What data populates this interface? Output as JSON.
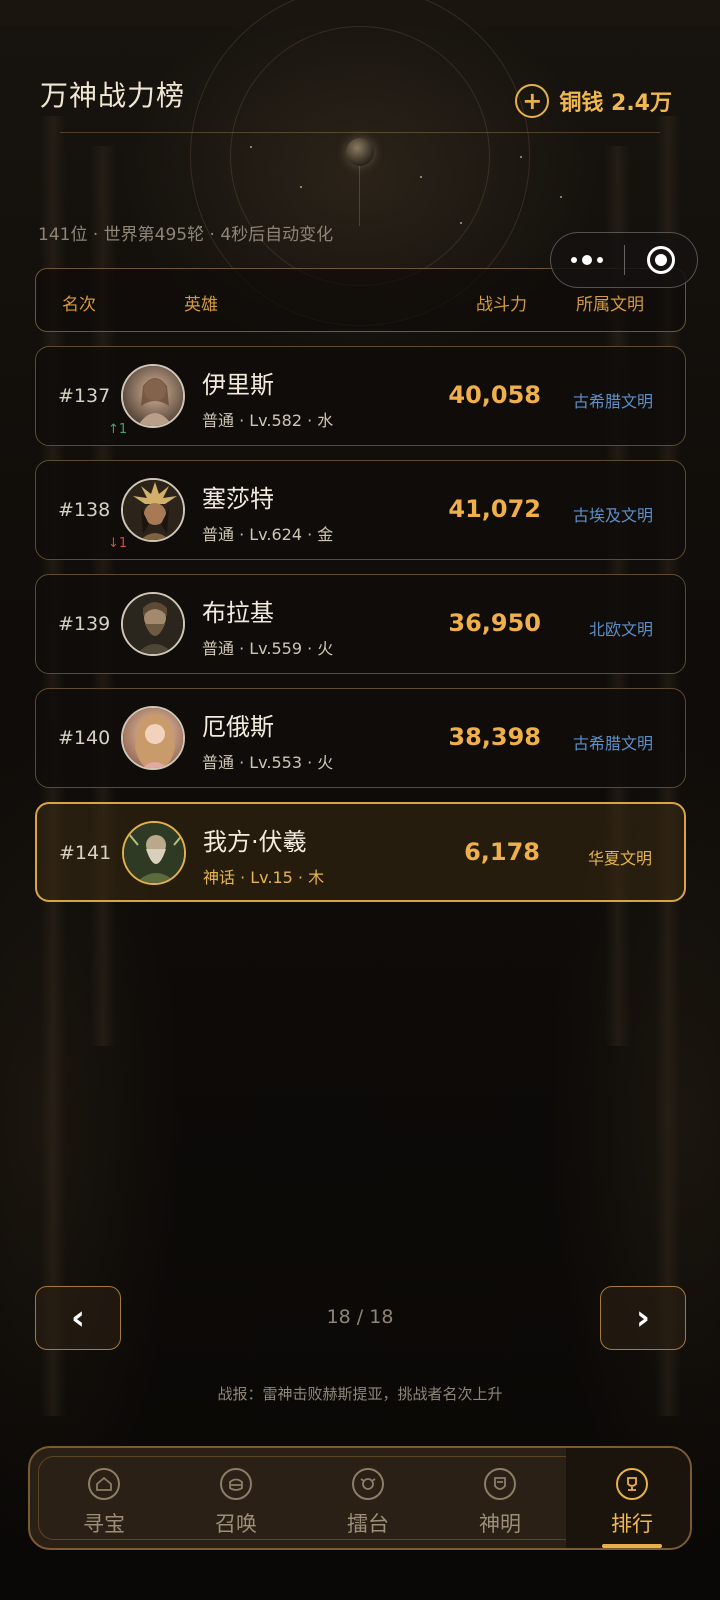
{
  "header": {
    "title": "万神战力榜",
    "coins_label": "铜钱 2.4万"
  },
  "subinfo": "141位 · 世界第495轮 · 4秒后自动变化",
  "table_header": {
    "rank": "名次",
    "hero": "英雄",
    "power": "战斗力",
    "civilization": "所属文明"
  },
  "rows": [
    {
      "rank": "#137",
      "name": "伊里斯",
      "meta": "普通 · Lv.582 · 水",
      "power": "40,058",
      "civ": "古希腊文明",
      "delta": "↑1",
      "delta_dir": "up",
      "avatar_color": "#8c6a55"
    },
    {
      "rank": "#138",
      "name": "塞莎特",
      "meta": "普通 · Lv.624 · 金",
      "power": "41,072",
      "civ": "古埃及文明",
      "delta": "↓1",
      "delta_dir": "down",
      "avatar_color": "#5a4a35"
    },
    {
      "rank": "#139",
      "name": "布拉基",
      "meta": "普通 · Lv.559 · 火",
      "power": "36,950",
      "civ": "北欧文明",
      "delta": "",
      "delta_dir": "",
      "avatar_color": "#5d5340"
    },
    {
      "rank": "#140",
      "name": "厄俄斯",
      "meta": "普通 · Lv.553 · 火",
      "power": "38,398",
      "civ": "古希腊文明",
      "delta": "",
      "delta_dir": "",
      "avatar_color": "#b07a63"
    },
    {
      "rank": "#141",
      "name": "我方·伏羲",
      "meta": "神话 · Lv.15 · 木",
      "power": "6,178",
      "civ": "华夏文明",
      "delta": "",
      "delta_dir": "",
      "avatar_color": "#4f5a3a"
    }
  ],
  "pager": {
    "prev": "‹",
    "next": "›",
    "page": "18 / 18"
  },
  "battle_report": "战报：雷神击败赫斯提亚，挑战者名次上升",
  "tabs": [
    {
      "label": "寻宝",
      "icon": "house-icon"
    },
    {
      "label": "召唤",
      "icon": "summon-icon"
    },
    {
      "label": "擂台",
      "icon": "arena-icon"
    },
    {
      "label": "神明",
      "icon": "deity-icon"
    },
    {
      "label": "排行",
      "icon": "ranking-icon",
      "active": true
    }
  ],
  "colors": {
    "accent_gold": "#e7b24a",
    "civ_blue": "#5e8fc7",
    "rank_up": "#3ca56a",
    "rank_down": "#d34a3e"
  }
}
